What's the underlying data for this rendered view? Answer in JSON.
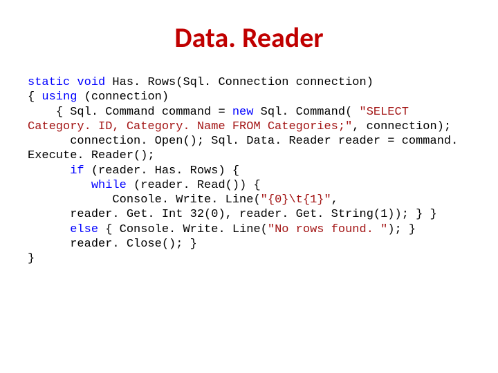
{
  "title": "Data. Reader",
  "code": {
    "kw_static": "static",
    "kw_void": "void",
    "fn_name": " Has. Rows(Sql. Connection connection)",
    "l2a": "{ ",
    "kw_using": "using",
    "l2b": " (connection)",
    "l3a": "    { Sql. Command command = ",
    "kw_new": "new",
    "l3b": " Sql. Command( ",
    "str1": "\"SELECT Category. ID, Category. Name FROM Categories;\"",
    "l3c": ", connection);",
    "l5": "      connection. Open(); Sql. Data. Reader reader = command. Execute. Reader();",
    "l6a": "      ",
    "kw_if": "if",
    "l6b": " (reader. Has. Rows) {",
    "l7a": "         ",
    "kw_while": "while",
    "l7b": " (reader. Read()) {",
    "l8a": "            Console. Write. Line(",
    "str2": "\"{0}\\t{1}\"",
    "l8b": ",",
    "l9": "      reader. Get. Int 32(0), reader. Get. String(1)); } }",
    "l10a": "      ",
    "kw_else": "else",
    "l10b": " { Console. Write. Line(",
    "str3": "\"No rows found. \"",
    "l10c": "); }",
    "l11": "      reader. Close(); }",
    "l12": "}"
  }
}
